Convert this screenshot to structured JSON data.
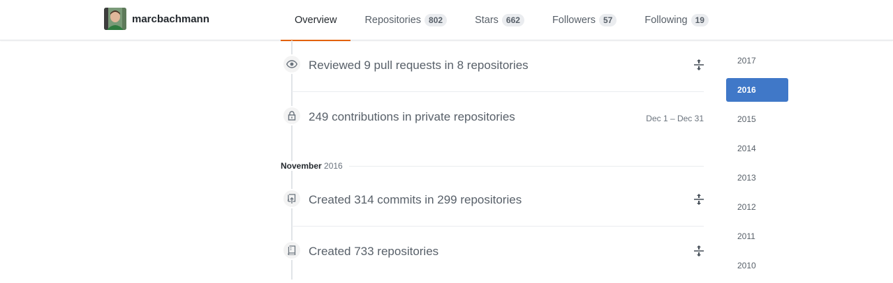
{
  "profile": {
    "username": "marcbachmann"
  },
  "tabs": [
    {
      "label": "Overview",
      "count": null,
      "selected": true
    },
    {
      "label": "Repositories",
      "count": "802"
    },
    {
      "label": "Stars",
      "count": "662"
    },
    {
      "label": "Followers",
      "count": "57"
    },
    {
      "label": "Following",
      "count": "19"
    }
  ],
  "timeline": {
    "items": [
      {
        "text": "Reviewed 9 pull requests in 8 repositories",
        "icon": "eye-icon"
      },
      {
        "text": "249 contributions in private repositories",
        "icon": "lock-icon",
        "date_range": "Dec 1 – Dec 31"
      },
      {
        "text": "Created 314 commits in 299 repositories",
        "icon": "repo-push-icon"
      },
      {
        "text": "Created 733 repositories",
        "icon": "repo-icon"
      }
    ],
    "month": {
      "name": "November",
      "year": "2016"
    }
  },
  "years": {
    "items": [
      "2017",
      "2016",
      "2015",
      "2014",
      "2013",
      "2012",
      "2011",
      "2010"
    ],
    "selected": "2016",
    "accent_color": "#4078c8"
  },
  "colors": {
    "tab_underline": "#e36209"
  }
}
